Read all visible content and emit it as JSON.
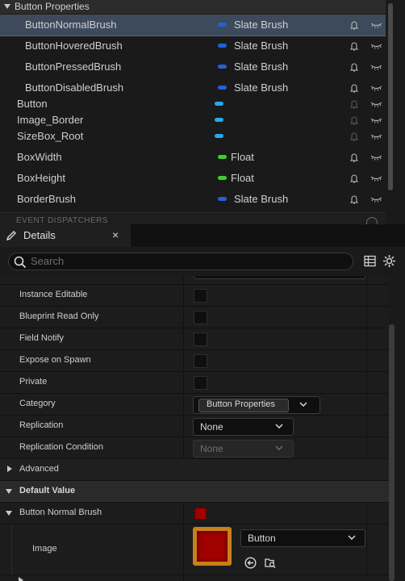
{
  "variables": {
    "category": "Button Properties",
    "items": [
      {
        "name": "ButtonNormalBrush",
        "type": "Slate Brush",
        "color": "#1f63d6",
        "selected": true
      },
      {
        "name": "ButtonHoveredBrush",
        "type": "Slate Brush",
        "color": "#1f63d6"
      },
      {
        "name": "ButtonPressedBrush",
        "type": "Slate Brush",
        "color": "#1f63d6"
      },
      {
        "name": "ButtonDisabledBrush",
        "type": "Slate Brush",
        "color": "#1f63d6"
      },
      {
        "name": "Button",
        "type": "",
        "color": "#25a8f0"
      },
      {
        "name": "Image_Border",
        "type": "",
        "color": "#25a8f0"
      },
      {
        "name": "SizeBox_Root",
        "type": "",
        "color": "#25a8f0"
      },
      {
        "name": "BoxWidth",
        "type": "Float",
        "color": "#3bd12a"
      },
      {
        "name": "BoxHeight",
        "type": "Float",
        "color": "#3bd12a"
      },
      {
        "name": "BorderBrush",
        "type": "Slate Brush",
        "color": "#1f63d6"
      }
    ],
    "event_dispatchers_label": "EVENT DISPATCHERS"
  },
  "details_tab": {
    "title": "Details",
    "close": "×"
  },
  "search": {
    "placeholder": "Search"
  },
  "details": {
    "rows": {
      "instance_editable": "Instance Editable",
      "blueprint_read_only": "Blueprint Read Only",
      "field_notify": "Field Notify",
      "expose_on_spawn": "Expose on Spawn",
      "private": "Private",
      "category": "Category",
      "category_value": "Button Properties",
      "replication": "Replication",
      "replication_value": "None",
      "replication_condition": "Replication Condition",
      "replication_condition_value": "None",
      "advanced": "Advanced",
      "default_value": "Default Value",
      "button_normal_brush": "Button Normal Brush",
      "image": "Image",
      "image_value": "Button"
    },
    "brush_color": "#a00000"
  }
}
